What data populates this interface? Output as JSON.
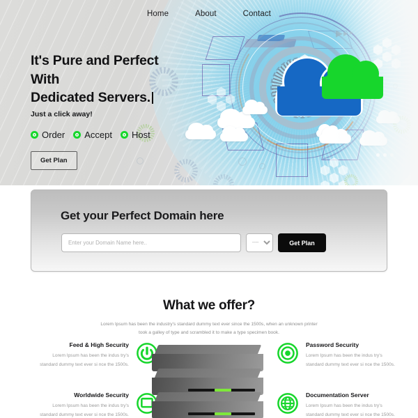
{
  "nav": {
    "items": [
      {
        "label": "Home"
      },
      {
        "label": "About"
      },
      {
        "label": "Contact"
      }
    ]
  },
  "hero": {
    "heading_line1": "It's Pure and Perfect",
    "heading_line2": "With",
    "heading_line3": "Dedicated Servers.",
    "subheading": "Just a click away!",
    "bullets": [
      {
        "label": "Order",
        "icon": "green-dot-icon"
      },
      {
        "label": "Accept",
        "icon": "green-dot-icon"
      },
      {
        "label": "Host",
        "icon": "green-dot-icon"
      }
    ],
    "cta_label": "Get Plan",
    "illustration": {
      "cloud_blue_color": "#1668c4",
      "cloud_green_color": "#17d62c",
      "glow_color": "#78cdeb"
    }
  },
  "domain": {
    "title": "Get your Perfect Domain here",
    "input_placeholder": "Enter your Domain Name here..",
    "input_value": "",
    "select_value": "----",
    "select_options": [
      "----"
    ],
    "button_label": "Get Plan"
  },
  "offer": {
    "title": "What we offer?",
    "description": "Lorem Ipsum has been the industry's standard dummy text ever since the 1500s, when an unknown printer took a galley of type and scrambled it to make a type specimen book.",
    "features_left": [
      {
        "title": "Feed & High Security",
        "body": "Lorem Ipsum has been the indus try's standard dummy text ever si nce the 1500s.",
        "icon": "power-icon"
      },
      {
        "title": "Worldwide Security",
        "body": "Lorem Ipsum has been the indus try's standard dummy text ever si nce the 1500s.",
        "icon": "monitor-icon"
      }
    ],
    "features_right": [
      {
        "title": "Password Security",
        "body": "Lorem Ipsum has been the indus try's standard dummy text ever si nce the 1500s.",
        "icon": "target-icon"
      },
      {
        "title": "Documentation Server",
        "body": "Lorem Ipsum has been the indus try's standard dummy text ever si nce the 1500s.",
        "icon": "globe-icon"
      }
    ],
    "accent_color": "#17d62c"
  }
}
